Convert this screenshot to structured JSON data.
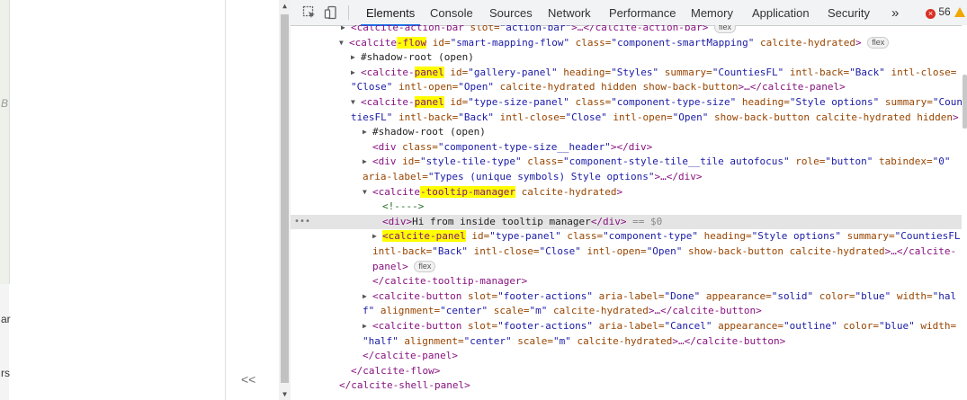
{
  "left_panel": {
    "edge_chars": [
      "B",
      "ar",
      "rs"
    ],
    "collapse_label": "<<"
  },
  "tabs": [
    {
      "label": "Elements",
      "active": true
    },
    {
      "label": "Console",
      "active": false
    },
    {
      "label": "Sources",
      "active": false
    },
    {
      "label": "Network",
      "active": false
    },
    {
      "label": "Performance",
      "active": false
    },
    {
      "label": "Memory",
      "active": false
    },
    {
      "label": "Application",
      "active": false
    },
    {
      "label": "Security",
      "active": false
    }
  ],
  "more_tabs_label": "»",
  "error_count": "56",
  "error_icon": "×",
  "selected_marker": "•••",
  "selected_suffix": " == $0",
  "flex_badge": "flex",
  "lines": {
    "l0": {
      "tag": "<calcite-action-bar",
      "a1": " slot=",
      "v1": "\"action-bar\"",
      "rest": ">…</calcite-action-bar>"
    },
    "l1": {
      "t1": "<calcite",
      "hl": "-flow",
      "a1": " id=",
      "v1": "\"smart-mapping-flow\"",
      "a2": " class=",
      "v2": "\"component-smartMapping\"",
      "a3": " calcite-hydrated",
      "t2": ">"
    },
    "l2": {
      "text": "#shadow-root (open)"
    },
    "l3": {
      "t1": "<calcite-",
      "hl": "panel",
      "a1": " id=",
      "v1": "\"gallery-panel\"",
      "a2": " heading=",
      "v2": "\"Styles\"",
      "a3": " summary=",
      "v3": "\"CountiesFL\"",
      "a4": " intl-back=",
      "v4": "\"Back\"",
      "a5": " intl-close="
    },
    "l4": {
      "v1": "\"Close\"",
      "a1": " intl-open=",
      "v2": "\"Open\"",
      "a2": " calcite-hydrated hidden show-back-button",
      "t1": ">…</calcite-panel>"
    },
    "l5": {
      "t1": "<calcite-",
      "hl": "panel",
      "a1": " id=",
      "v1": "\"type-size-panel\"",
      "a2": " class=",
      "v2": "\"component-type-size\"",
      "a3": " heading=",
      "v3": "\"Style options\"",
      "a4": " summary=",
      "v4": "\"Coun"
    },
    "l6": {
      "v1": "tiesFL\"",
      "a1": " intl-back=",
      "v2": "\"Back\"",
      "a2": " intl-close=",
      "v3": "\"Close\"",
      "a3": " intl-open=",
      "v4": "\"Open\"",
      "a4": " show-back-button calcite-hydrated hidden",
      "t1": ">"
    },
    "l7": {
      "text": "#shadow-root (open)"
    },
    "l8": {
      "t1": "<div",
      "a1": " class=",
      "v1": "\"component-type-size__header\"",
      "t2": "></div>"
    },
    "l9": {
      "t1": "<div",
      "a1": " id=",
      "v1": "\"style-tile-type\"",
      "a2": " class=",
      "v2": "\"component-style-tile__tile autofocus\"",
      "a3": " role=",
      "v3": "\"button\"",
      "a4": " tabindex=",
      "v4": "\"0\""
    },
    "l10": {
      "a1": "aria-label=",
      "v1": "\"Types (unique symbols) Style options\"",
      "t1": ">…</div>"
    },
    "l11": {
      "t1": "<calcite",
      "hl": "-tooltip-manager",
      "a1": " calcite-hydrated",
      "t2": ">"
    },
    "l12": {
      "text": "<!---->"
    },
    "l13": {
      "t1": "<div>",
      "txt": "Hi from inside tooltip manager",
      "t2": "</div>"
    },
    "l14": {
      "hl": "<calcite-panel",
      "a1": " id=",
      "v1": "\"type-panel\"",
      "a2": " class=",
      "v2": "\"component-type\"",
      "a3": " heading=",
      "v3": "\"Style options\"",
      "a4": " summary=",
      "v4": "\"CountiesFL\""
    },
    "l15": {
      "a1": "intl-back=",
      "v1": "\"Back\"",
      "a2": " intl-close=",
      "v2": "\"Close\"",
      "a3": " intl-open=",
      "v3": "\"Open\"",
      "a4": " show-back-button calcite-hydrated",
      "t1": ">…</calcite-"
    },
    "l16": {
      "t1": "panel>"
    },
    "l17": {
      "t1": "</calcite-tooltip-manager>"
    },
    "l18": {
      "t1": "<calcite-button",
      "a1": " slot=",
      "v1": "\"footer-actions\"",
      "a2": " aria-label=",
      "v2": "\"Done\"",
      "a3": " appearance=",
      "v3": "\"solid\"",
      "a4": " color=",
      "v4": "\"blue\"",
      "a5": " width=",
      "v5": "\"hal"
    },
    "l19": {
      "v1": "f\"",
      "a1": " alignment=",
      "v2": "\"center\"",
      "a2": " scale=",
      "v3": "\"m\"",
      "a3": " calcite-hydrated",
      "t1": ">…</calcite-button>"
    },
    "l20": {
      "t1": "<calcite-button",
      "a1": " slot=",
      "v1": "\"footer-actions\"",
      "a2": " aria-label=",
      "v2": "\"Cancel\"",
      "a3": " appearance=",
      "v3": "\"outline\"",
      "a4": " color=",
      "v4": "\"blue\"",
      "a5": " width="
    },
    "l21": {
      "v1": "\"half\"",
      "a1": " alignment=",
      "v2": "\"center\"",
      "a2": " scale=",
      "v3": "\"m\"",
      "a3": " calcite-hydrated",
      "t1": ">…</calcite-button>"
    },
    "l22": {
      "t1": "</calcite-panel>"
    },
    "l23": {
      "t1": "</calcite-flow>"
    },
    "l24": {
      "t1": "</calcite-shell-panel>"
    }
  }
}
